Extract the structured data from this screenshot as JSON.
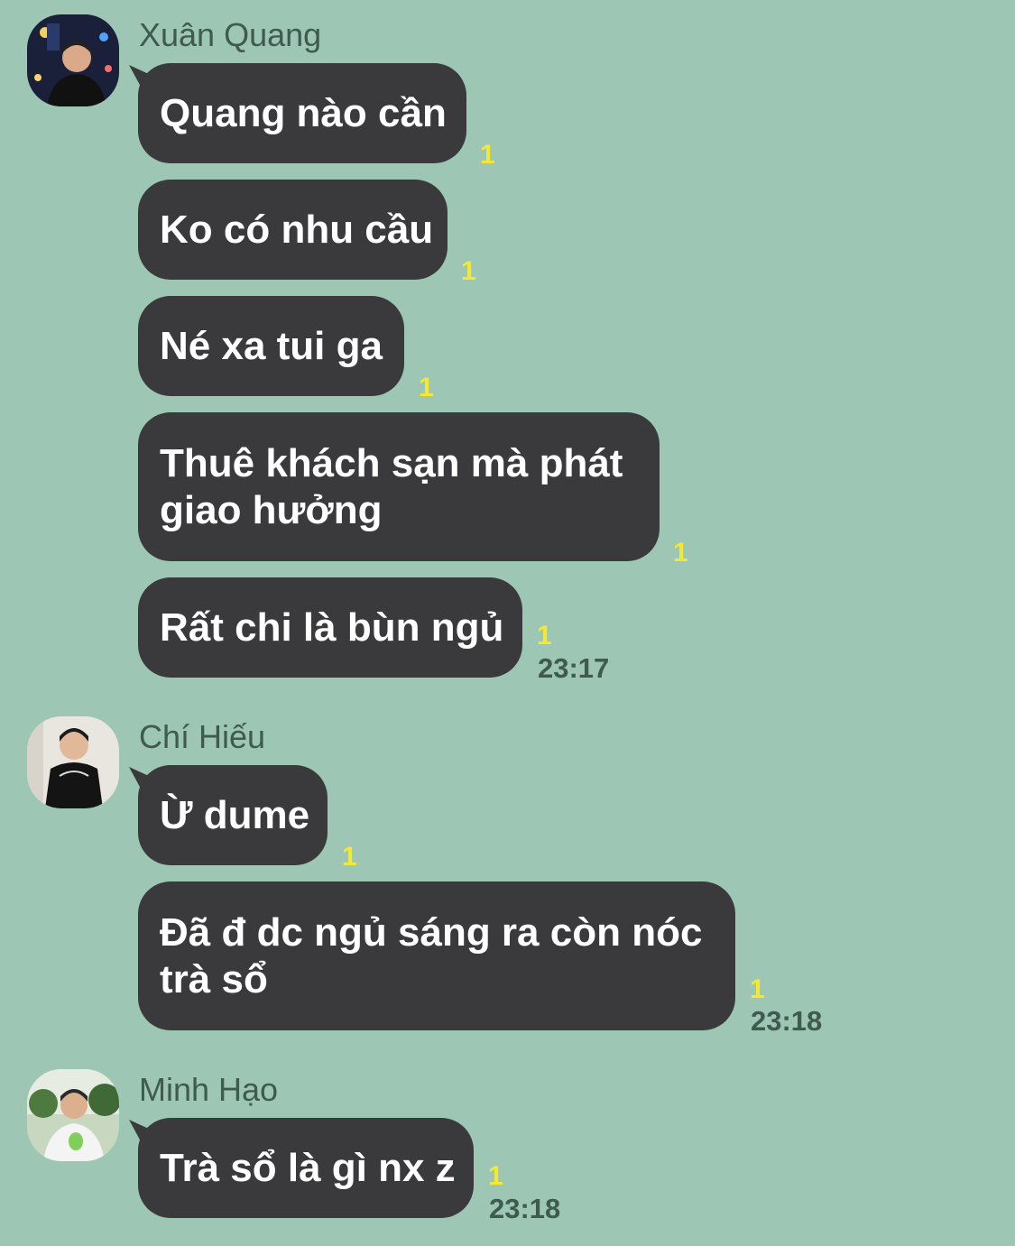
{
  "groups": [
    {
      "sender": "Xuân Quang",
      "messages": [
        {
          "text_lines": [
            "Quang nào cần"
          ],
          "unread": "1"
        },
        {
          "text_lines": [
            "Ko có nhu cầu"
          ],
          "unread": "1"
        },
        {
          "text_lines": [
            "Né xa tui ga"
          ],
          "unread": "1"
        },
        {
          "text_lines": [
            "Thuê khách sạn mà phát",
            "giao hưởng"
          ],
          "unread": "1"
        },
        {
          "text_lines": [
            "Rất chi là bùn ngủ"
          ],
          "unread": "1",
          "time": "23:17"
        }
      ]
    },
    {
      "sender": "Chí Hiếu",
      "messages": [
        {
          "text_lines": [
            "Ừ dume"
          ],
          "unread": "1"
        },
        {
          "text_lines": [
            "Đã đ dc ngủ sáng ra còn nóc",
            "trà sổ"
          ],
          "unread": "1",
          "time": "23:18"
        }
      ]
    },
    {
      "sender": "Minh Hạo",
      "messages": [
        {
          "text_lines": [
            "Trà sổ là gì nx z"
          ],
          "unread": "1",
          "time": "23:18"
        }
      ]
    }
  ],
  "colors": {
    "background": "#9dc6b5",
    "bubble": "#3a3a3c",
    "unread": "#f4e832",
    "meta_text": "#3f5a4f"
  }
}
